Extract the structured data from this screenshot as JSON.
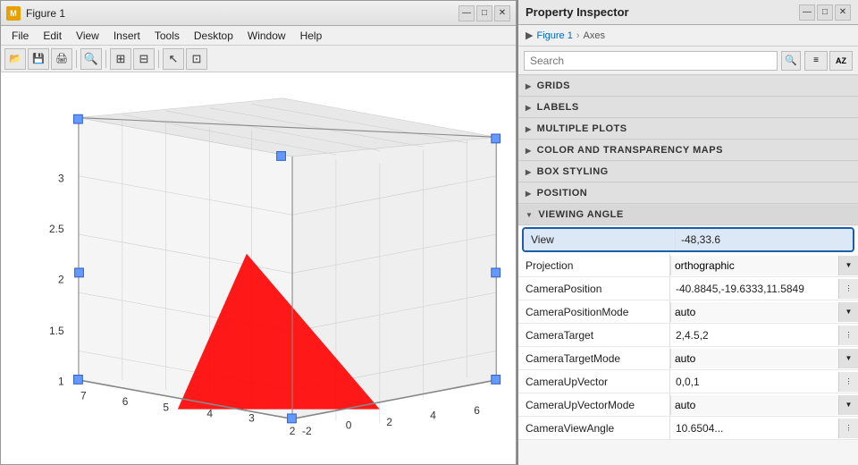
{
  "figure": {
    "title": "Figure 1",
    "icon_label": "M",
    "menu_items": [
      "File",
      "Edit",
      "View",
      "Insert",
      "Tools",
      "Desktop",
      "Window",
      "Help"
    ],
    "toolbar_buttons": [
      {
        "name": "open",
        "icon": "📂"
      },
      {
        "name": "save",
        "icon": "💾"
      },
      {
        "name": "print",
        "icon": "🖨"
      },
      {
        "name": "inspect",
        "icon": "🔍"
      },
      {
        "name": "link1",
        "icon": "⊞"
      },
      {
        "name": "link2",
        "icon": "⊟"
      },
      {
        "name": "cursor",
        "icon": "↖"
      },
      {
        "name": "pan",
        "icon": "⊡"
      }
    ],
    "title_controls": [
      "—",
      "□",
      "✕"
    ],
    "plot": {
      "axis_labels": {
        "z_ticks": [
          "1",
          "1.5",
          "2",
          "2.5",
          "3"
        ],
        "x_ticks": [
          "2",
          "3",
          "4",
          "5",
          "6",
          "7"
        ],
        "y_ticks": [
          "-2",
          "0",
          "2",
          "4",
          "6"
        ],
        "z_axis": "",
        "x_axis": "",
        "y_axis": ""
      }
    }
  },
  "property_inspector": {
    "title": "Property Inspector",
    "title_controls": [
      "—",
      "□",
      "✕"
    ],
    "breadcrumb": {
      "root": "Figure 1",
      "child": "Axes"
    },
    "search": {
      "placeholder": "Search",
      "icon": "🔍"
    },
    "sections": [
      {
        "id": "grids",
        "label": "GRIDS",
        "expanded": false
      },
      {
        "id": "labels",
        "label": "LABELS",
        "expanded": false
      },
      {
        "id": "multiple_plots",
        "label": "MULTIPLE PLOTS",
        "expanded": false
      },
      {
        "id": "color_transparency",
        "label": "COLOR AND TRANSPARENCY MAPS",
        "expanded": false
      },
      {
        "id": "box_styling",
        "label": "BOX STYLING",
        "expanded": false
      },
      {
        "id": "position",
        "label": "POSITION",
        "expanded": false
      },
      {
        "id": "viewing_angle",
        "label": "VIEWING ANGLE",
        "expanded": true,
        "properties": [
          {
            "name": "View",
            "value": "-48,33.6",
            "type": "text",
            "highlighted": true
          },
          {
            "name": "Projection",
            "value": "orthographic",
            "type": "dropdown"
          },
          {
            "name": "CameraPosition",
            "value": "-40.8845,-19.6333,11.5849",
            "type": "text_options"
          },
          {
            "name": "CameraPositionMode",
            "value": "auto",
            "type": "dropdown"
          },
          {
            "name": "CameraTarget",
            "value": "2,4.5,2",
            "type": "text_options"
          },
          {
            "name": "CameraTargetMode",
            "value": "auto",
            "type": "dropdown"
          },
          {
            "name": "CameraUpVector",
            "value": "0,0,1",
            "type": "text_options"
          },
          {
            "name": "CameraUpVectorMode",
            "value": "auto",
            "type": "dropdown"
          },
          {
            "name": "CameraViewAngle",
            "value": "10.6504...",
            "type": "text_options"
          }
        ]
      }
    ],
    "icons": {
      "sort_icon": "≡",
      "az_icon": "AZ"
    }
  }
}
